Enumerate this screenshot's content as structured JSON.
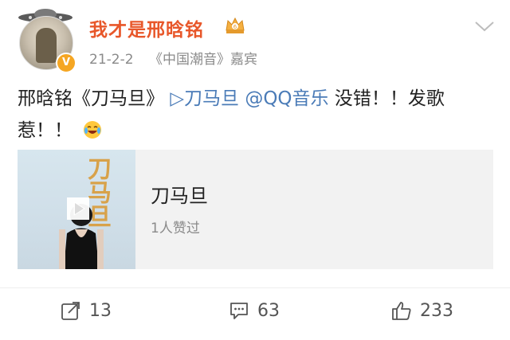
{
  "header": {
    "username": "我才是邢晗铭",
    "date": "21-2-2",
    "source": "《中国潮音》嘉宾",
    "verified_badge": "V"
  },
  "content": {
    "text_part1": "邢晗铭《刀马旦》",
    "music_link": "▷刀马旦",
    "mention": "@QQ音乐",
    "text_part2": "没错！！发歌惹！！",
    "emoji": "laughing-crying-emoji"
  },
  "card": {
    "title": "刀马旦",
    "subtitle": "1人赞过",
    "cover_title": "刀马旦"
  },
  "actions": {
    "repost_count": "13",
    "comment_count": "63",
    "like_count": "233"
  },
  "colors": {
    "username": "#e8572a",
    "link": "#4a7bb7",
    "badge": "#f5a623"
  }
}
